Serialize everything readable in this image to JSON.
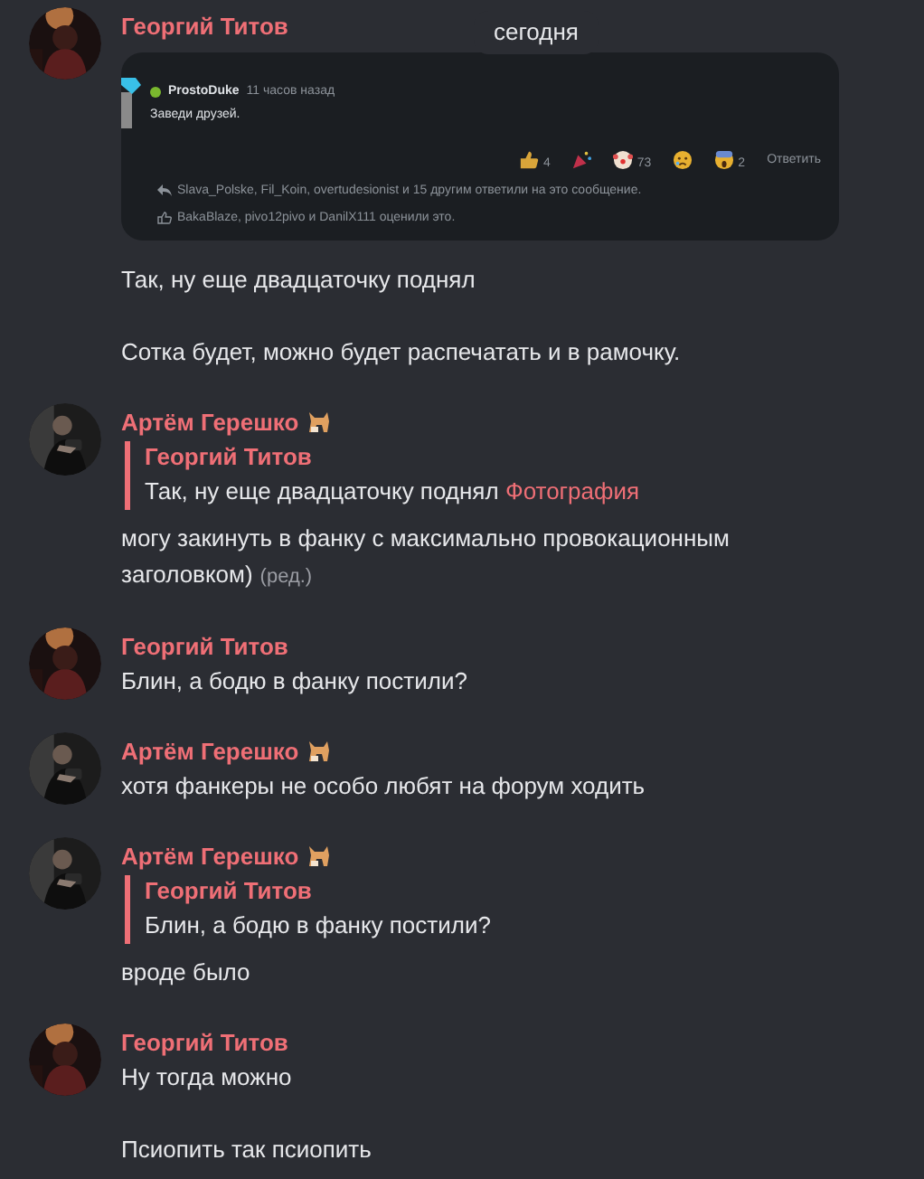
{
  "date_divider": "сегодня",
  "messages": [
    {
      "author": "Георгий Титов",
      "badge": false,
      "embed": {
        "author": "ProstoDuke",
        "online": true,
        "time": "11 часов назад",
        "text": "Заведи друзей.",
        "reactions": [
          {
            "kind": "thumb",
            "count": "4"
          },
          {
            "kind": "party"
          },
          {
            "kind": "clown",
            "count": "73"
          },
          {
            "kind": "sad"
          },
          {
            "kind": "scream",
            "count": "2"
          }
        ],
        "reply_button": "Ответить",
        "replies_note": "Slava_Polske, Fil_Koin, overtudesionist и 15 другим ответили на это сообщение.",
        "likes_note": "BakaBlaze, pivo12pivo и DanilX111 оценили это."
      },
      "paragraphs": [
        "Так, ну еще двадцаточку поднял",
        "Сотка будет, можно будет распечатать и в рамочку."
      ]
    },
    {
      "author": "Артём Герешко",
      "badge": true,
      "quote": {
        "author": "Георгий Титов",
        "text": "Так, ну еще двадцаточку поднял",
        "link": "Фотография"
      },
      "paragraphs": [
        "могу закинуть в фанку с максимально провокационным заголовком)"
      ],
      "edited": "(ред.)"
    },
    {
      "author": "Георгий Титов",
      "badge": false,
      "paragraphs": [
        "Блин, а бодю в фанку постили?"
      ]
    },
    {
      "author": "Артём Герешко",
      "badge": true,
      "paragraphs": [
        "хотя фанкеры не особо любят на форум ходить"
      ]
    },
    {
      "author": "Артём Герешко",
      "badge": true,
      "quote": {
        "author": "Георгий Титов",
        "text": "Блин, а бодю в фанку постили?"
      },
      "paragraphs": [
        "вроде было"
      ]
    },
    {
      "author": "Георгий Титов",
      "badge": false,
      "paragraphs": [
        "Ну тогда можно",
        "Псиопить так псиопить"
      ]
    }
  ]
}
